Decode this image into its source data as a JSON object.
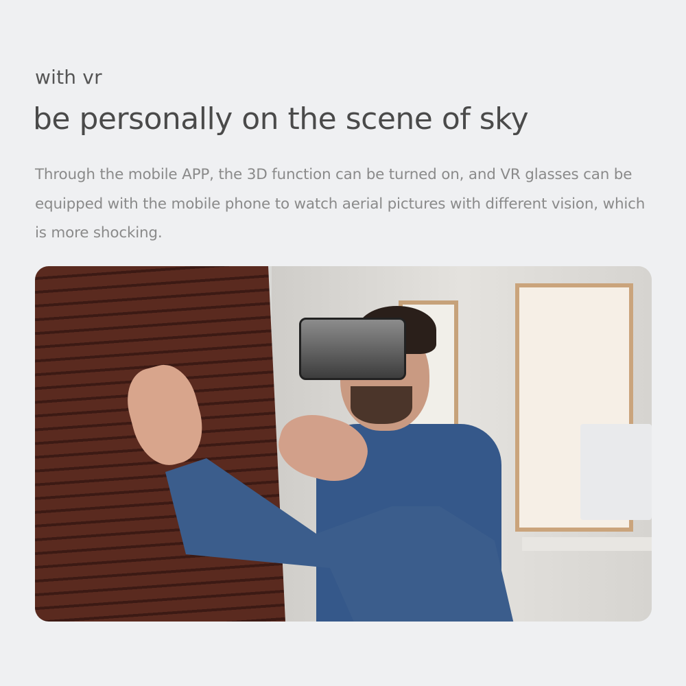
{
  "subtitle": "with vr",
  "title": "be personally on the scene of sky",
  "description": "Through the mobile APP, the 3D function can be turned on, and VR glasses can be equipped with the mobile phone to watch aerial pictures with different vision, which is more shocking."
}
